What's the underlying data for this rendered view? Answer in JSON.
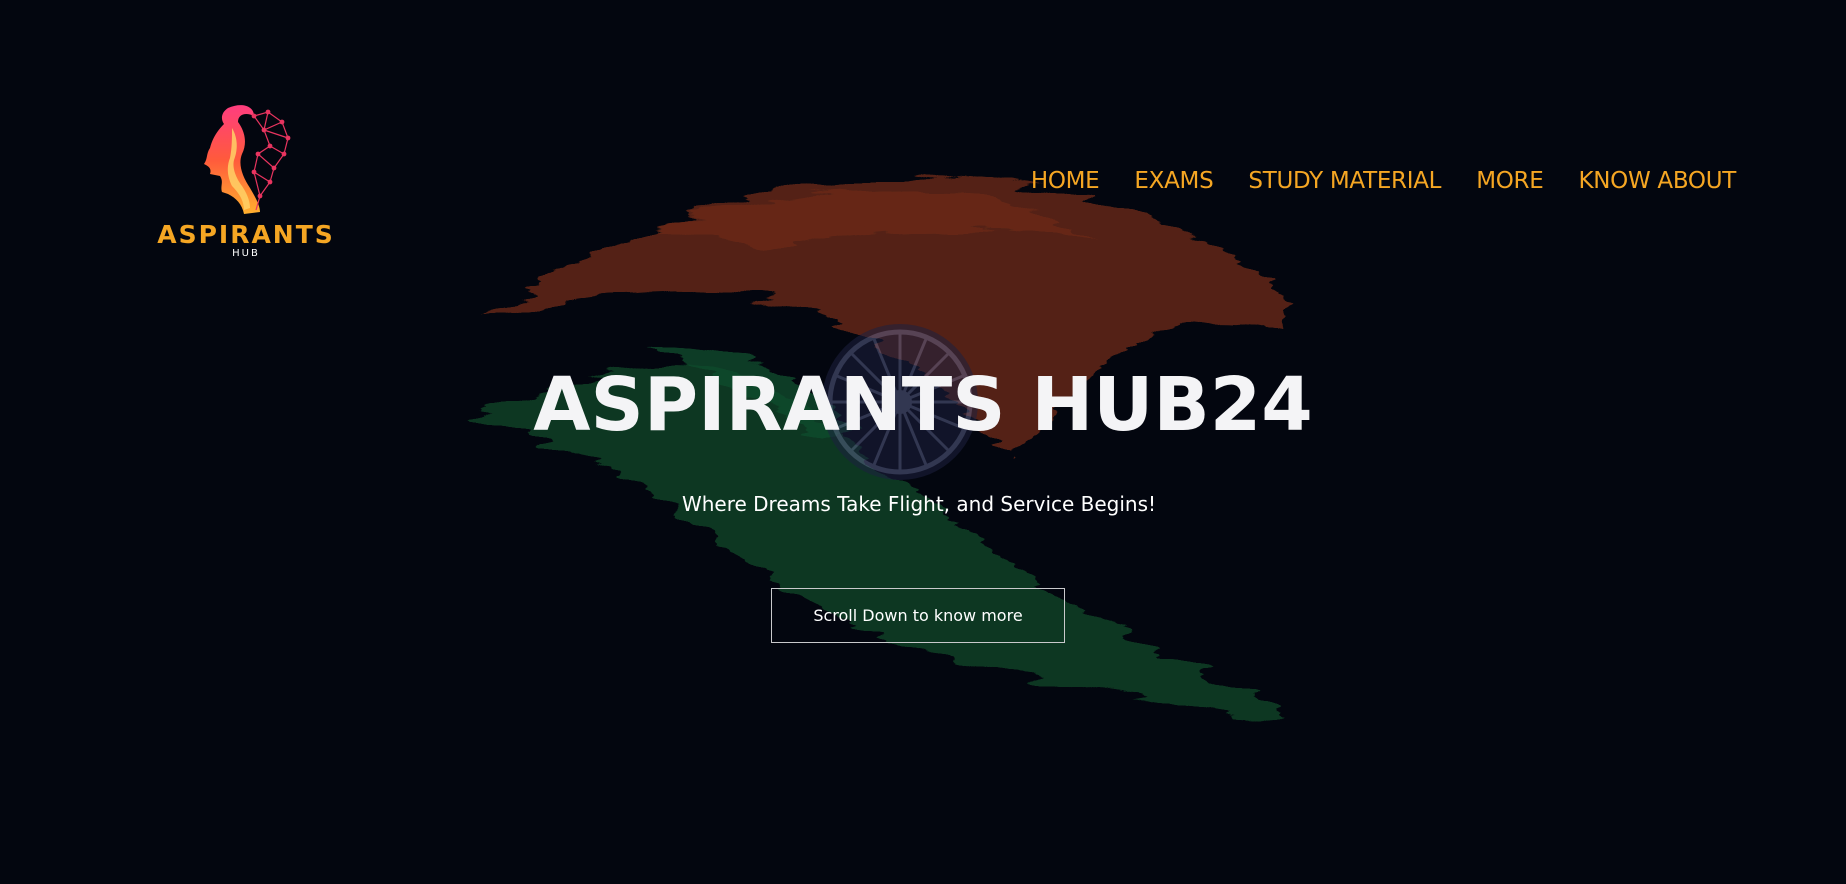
{
  "brand": {
    "logo_word": "ASPIRANTS",
    "logo_sub": "HUB"
  },
  "nav": {
    "items": [
      {
        "label": "HOME"
      },
      {
        "label": "EXAMS"
      },
      {
        "label": "STUDY MATERIAL"
      },
      {
        "label": "MORE"
      },
      {
        "label": "KNOW ABOUT"
      }
    ]
  },
  "hero": {
    "title": "ASPIRANTS HUB24",
    "subtitle": "Where Dreams Take Flight, and Service Begins!",
    "cta_label": "Scroll Down to know more"
  },
  "colors": {
    "background": "#03060f",
    "accent": "#f5a623",
    "saffron_stroke": "#5a2415",
    "green_stroke": "#0d3a22",
    "chakra": "#3a3f66"
  },
  "icons": {
    "logo_mark": "head-network-icon",
    "background_art": "indian-flag-brush-stroke"
  }
}
